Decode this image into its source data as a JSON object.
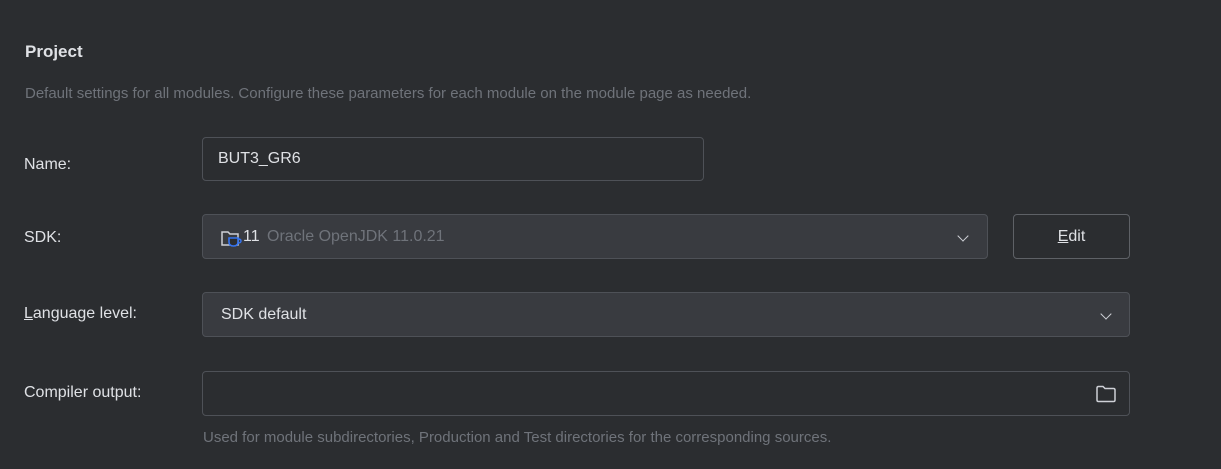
{
  "section": {
    "title": "Project",
    "subtitle": "Default settings for all modules. Configure these parameters for each module on the module page as needed."
  },
  "name_row": {
    "label": "Name:",
    "value": "BUT3_GR6"
  },
  "sdk_row": {
    "label": "SDK:",
    "version": "11",
    "description": "Oracle OpenJDK 11.0.21",
    "icon": "jdk-folder-icon",
    "edit_button": "Edit"
  },
  "language_row": {
    "label_mnemonic": "L",
    "label_rest": "anguage level:",
    "value": "SDK default"
  },
  "compiler_row": {
    "label": "Compiler output:",
    "value": "",
    "hint": "Used for module subdirectories, Production and Test directories for the corresponding sources."
  },
  "colors": {
    "background": "#2b2d30",
    "text": "#dfe1e5",
    "muted": "#6f737a",
    "accent": "#3574f0"
  }
}
